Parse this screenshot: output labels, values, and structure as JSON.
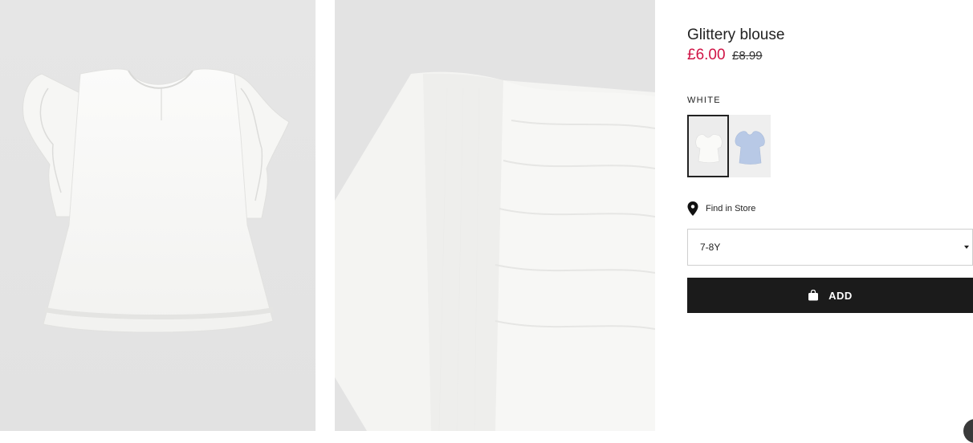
{
  "product": {
    "title": "Glittery blouse",
    "price_sale": "£6.00",
    "price_original": "£8.99",
    "color_label": "WHITE",
    "swatches": [
      {
        "name": "white",
        "selected": true
      },
      {
        "name": "light blue",
        "selected": false
      }
    ],
    "find_in_store": "Find in Store",
    "size_selected": "7-8Y",
    "add_label": "ADD"
  },
  "colors": {
    "sale_red": "#d01345",
    "button_black": "#1b1b1b",
    "swatch_blue": "#b8c9e6"
  },
  "icons": [
    "location-pin-icon",
    "shopping-bag-icon",
    "chevron-down-icon"
  ]
}
